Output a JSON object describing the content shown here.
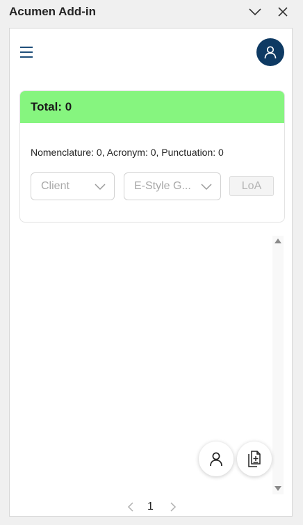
{
  "window": {
    "title": "Acumen Add-in",
    "collapse_icon": "chevron-down-icon",
    "close_icon": "close-icon"
  },
  "header": {
    "menu_icon": "hamburger-menu-icon",
    "profile_icon": "user-icon",
    "accent": "#0e3a63"
  },
  "summary": {
    "total_label": "Total: 0",
    "header_color": "#86f57f",
    "counts_text": "Nomenclature: 0, Acronym: 0, Punctuation: 0"
  },
  "filters": {
    "client_placeholder": "Client",
    "style_placeholder": "E-Style G...",
    "loa_label": "LoA"
  },
  "fabs": {
    "user_icon": "user-icon",
    "document_icon": "document-add-icon"
  },
  "pagination": {
    "current_page": "1"
  }
}
